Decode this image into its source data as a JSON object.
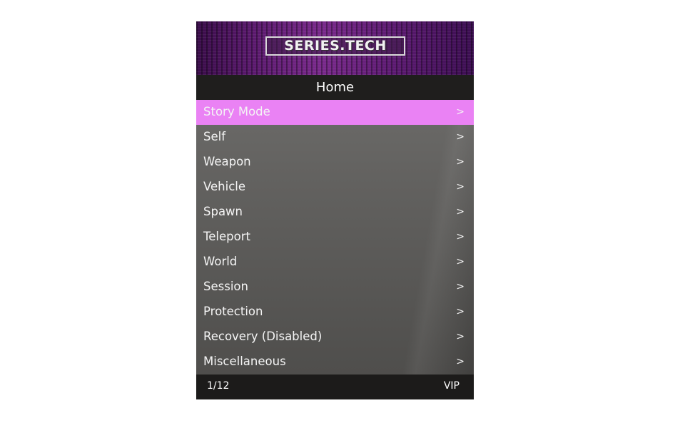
{
  "banner": {
    "logo_text": "SERIES.TECH",
    "colors": {
      "accent": "#7a2a8c"
    }
  },
  "header": {
    "title": "Home"
  },
  "menu": {
    "selected_index": 0,
    "highlight_color": "#ea82f4",
    "items": [
      {
        "label": "Story Mode",
        "arrow": ">"
      },
      {
        "label": "Self",
        "arrow": ">"
      },
      {
        "label": "Weapon",
        "arrow": ">"
      },
      {
        "label": "Vehicle",
        "arrow": ">"
      },
      {
        "label": "Spawn",
        "arrow": ">"
      },
      {
        "label": "Teleport",
        "arrow": ">"
      },
      {
        "label": "World",
        "arrow": ">"
      },
      {
        "label": "Session",
        "arrow": ">"
      },
      {
        "label": "Protection",
        "arrow": ">"
      },
      {
        "label": "Recovery (Disabled)",
        "arrow": ">"
      },
      {
        "label": "Miscellaneous",
        "arrow": ">"
      }
    ]
  },
  "footer": {
    "page_indicator": "1/12",
    "tier": "VIP"
  }
}
